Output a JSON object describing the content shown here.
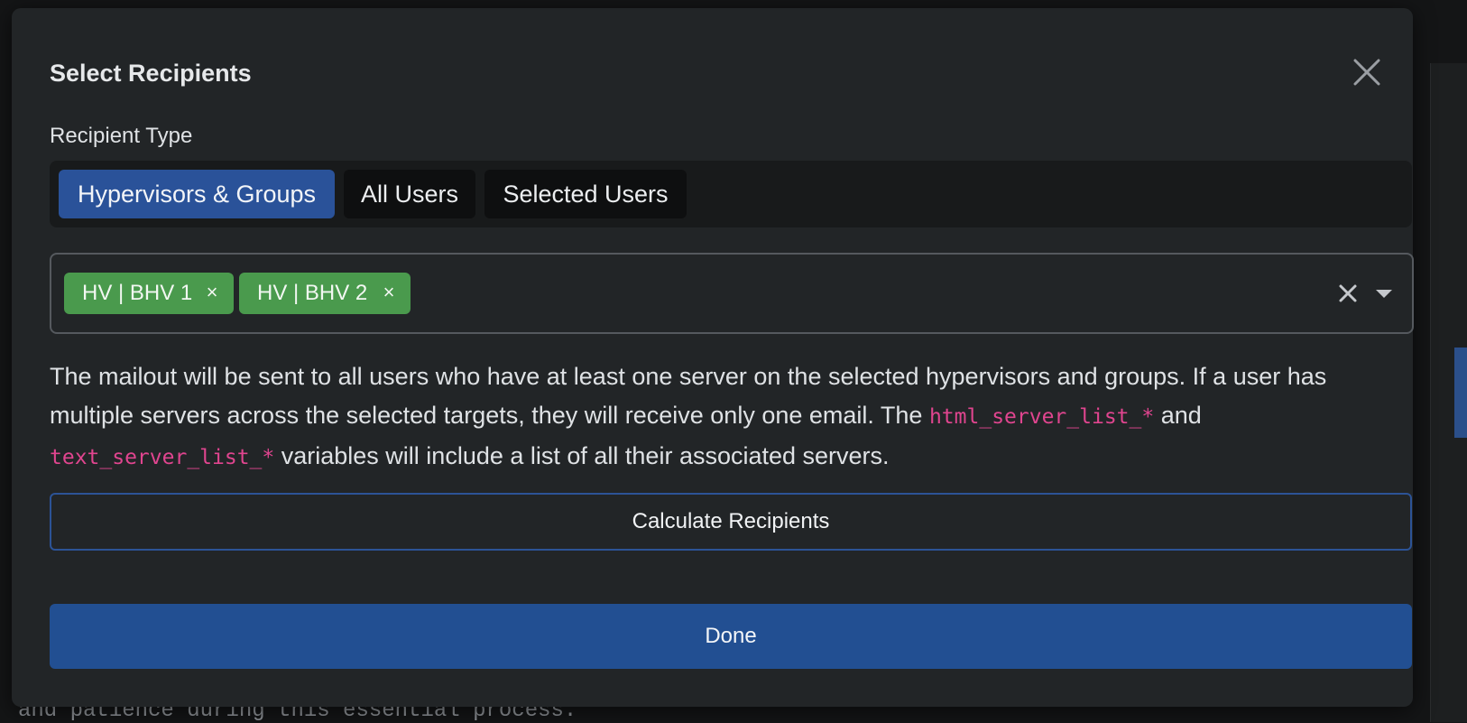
{
  "dialog": {
    "title": "Select Recipients",
    "close_icon": "close-icon",
    "recipient_type_label": "Recipient Type",
    "tabs": [
      {
        "label": "Hypervisors & Groups",
        "active": true
      },
      {
        "label": "All Users",
        "active": false
      },
      {
        "label": "Selected Users",
        "active": false
      }
    ],
    "selected_chips": [
      {
        "label": "HV | BHV 1",
        "remove_glyph": "×"
      },
      {
        "label": "HV | BHV 2",
        "remove_glyph": "×"
      }
    ],
    "select_controls": {
      "clear_icon": "clear-icon",
      "caret_icon": "chevron-down-icon"
    },
    "description": {
      "part1": "The mailout will be sent to all users who have at least one server on the selected hypervisors and groups. If a user has multiple servers across the selected targets, they will receive only one email. The ",
      "code1": "html_server_list_*",
      "part2": " and ",
      "code2": "text_server_list_*",
      "part3": " variables will include a list of all their associated servers."
    },
    "calculate_button": "Calculate Recipients",
    "done_button": "Done"
  },
  "background": {
    "bottom_text": "and patience during this essential process."
  },
  "colors": {
    "modal_bg": "#222527",
    "active_tab": "#2a5299",
    "chip_green": "#4a9a4d",
    "code_pink": "#e0458f",
    "done_button": "#224f92"
  }
}
